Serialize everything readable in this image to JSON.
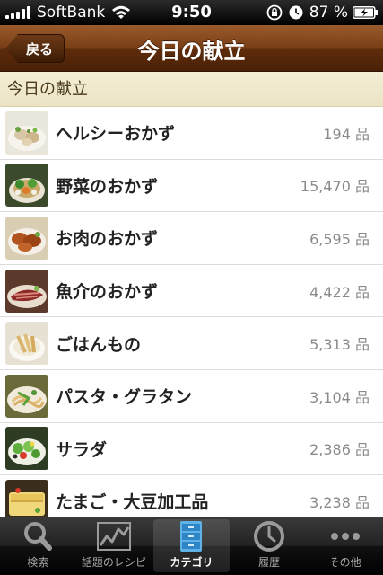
{
  "status_bar": {
    "carrier": "SoftBank",
    "time": "9:50",
    "battery": "87 %"
  },
  "nav": {
    "back_label": "戻る",
    "title": "今日の献立"
  },
  "section": {
    "header": "今日の献立"
  },
  "items": [
    {
      "label": "ヘルシーおかず",
      "count": "194 品"
    },
    {
      "label": "野菜のおかず",
      "count": "15,470 品"
    },
    {
      "label": "お肉のおかず",
      "count": "6,595 品"
    },
    {
      "label": "魚介のおかず",
      "count": "4,422 品"
    },
    {
      "label": "ごはんもの",
      "count": "5,313 品"
    },
    {
      "label": "パスタ・グラタン",
      "count": "3,104 品"
    },
    {
      "label": "サラダ",
      "count": "2,386 品"
    },
    {
      "label": "たまご・大豆加工品",
      "count": "3,238 品"
    }
  ],
  "tabs": [
    {
      "label": "検索"
    },
    {
      "label": "話題のレシピ"
    },
    {
      "label": "カテゴリ"
    },
    {
      "label": "履歴"
    },
    {
      "label": "その他"
    }
  ],
  "colors": {
    "nav_brown": "#6b3412",
    "section_bg": "#f1ecd2",
    "count_gray": "#8a8a8a"
  }
}
